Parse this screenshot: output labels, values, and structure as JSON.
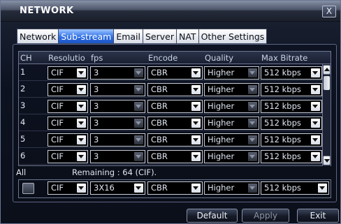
{
  "window": {
    "title": "NETWORK",
    "close_label": "X"
  },
  "tabs": [
    "Network",
    "Sub-stream",
    "Email",
    "Server",
    "NAT",
    "Other Settings"
  ],
  "active_tab": "Sub-stream",
  "table": {
    "headers": {
      "ch": "CH",
      "resolution": "Resolutio",
      "fps": "fps",
      "encode": "Encode",
      "quality": "Quality",
      "max_bitrate": "Max Bitrate"
    },
    "rows": [
      {
        "ch": "1",
        "resolution": "CIF",
        "fps": "3",
        "encode": "CBR",
        "quality": "Higher",
        "max_bitrate": "512 kbps"
      },
      {
        "ch": "2",
        "resolution": "CIF",
        "fps": "3",
        "encode": "CBR",
        "quality": "Higher",
        "max_bitrate": "512 kbps"
      },
      {
        "ch": "3",
        "resolution": "CIF",
        "fps": "3",
        "encode": "CBR",
        "quality": "Higher",
        "max_bitrate": "512 kbps"
      },
      {
        "ch": "4",
        "resolution": "CIF",
        "fps": "3",
        "encode": "CBR",
        "quality": "Higher",
        "max_bitrate": "512 kbps"
      },
      {
        "ch": "5",
        "resolution": "CIF",
        "fps": "3",
        "encode": "CBR",
        "quality": "Higher",
        "max_bitrate": "512 kbps"
      },
      {
        "ch": "6",
        "resolution": "CIF",
        "fps": "3",
        "encode": "CBR",
        "quality": "Higher",
        "max_bitrate": "512 kbps"
      }
    ]
  },
  "all": {
    "label": "All",
    "remaining": "Remaining : 64 (CIF).",
    "resolution": "CIF",
    "fps": "3X16",
    "encode": "CBR",
    "quality": "Higher",
    "max_bitrate": "512 kbps"
  },
  "buttons": {
    "default": "Default",
    "apply": "Apply",
    "exit": "Exit"
  },
  "icons": {
    "close": "close-icon",
    "dropdown": "chevron-down-icon",
    "scroll_up": "arrow-up-icon",
    "scroll_down": "arrow-down-icon",
    "checkbox": "checkbox-icon"
  },
  "colors": {
    "active_tab": "#2d6fe6",
    "background": "#0b0f1a",
    "select_bg": "#000000"
  }
}
